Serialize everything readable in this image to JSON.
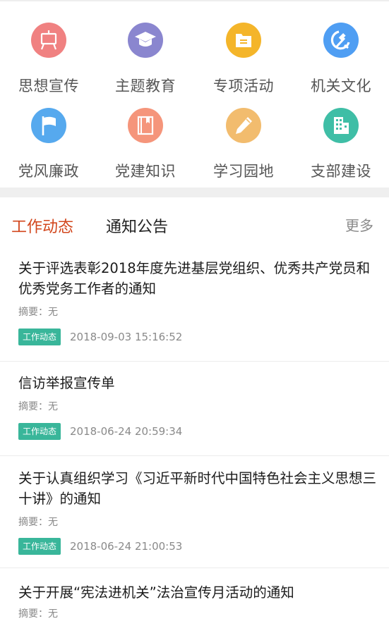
{
  "menu": [
    {
      "label": "思想宣传",
      "icon": "blackboard-icon",
      "color": "#f08181"
    },
    {
      "label": "主题教育",
      "icon": "graduation-cap-icon",
      "color": "#8a86cf"
    },
    {
      "label": "专项活动",
      "icon": "folder-icon",
      "color": "#f4b52a"
    },
    {
      "label": "机关文化",
      "icon": "hammer-sickle-icon",
      "color": "#4f9ef3"
    },
    {
      "label": "党风廉政",
      "icon": "flag-icon",
      "color": "#56a9ee"
    },
    {
      "label": "党建知识",
      "icon": "book-icon",
      "color": "#f5957b"
    },
    {
      "label": "学习园地",
      "icon": "pencil-icon",
      "color": "#f2bc6e"
    },
    {
      "label": "支部建设",
      "icon": "building-icon",
      "color": "#3fbea6"
    }
  ],
  "tabs": {
    "active": "工作动态",
    "other": "通知公告",
    "more": "更多"
  },
  "accent_color": "#d2461c",
  "badge_color": "#39b69a",
  "news": [
    {
      "title": "关于评选表彰2018年度先进基层党组织、优秀共产党员和优秀党务工作者的通知",
      "summary": "摘要：无",
      "tag": "工作动态",
      "time": "2018-09-03 15:16:52"
    },
    {
      "title": "信访举报宣传单",
      "summary": "摘要：无",
      "tag": "工作动态",
      "time": "2018-06-24 20:59:34"
    },
    {
      "title": "关于认真组织学习《习近平新时代中国特色社会主义思想三十讲》的通知",
      "summary": "摘要：无",
      "tag": "工作动态",
      "time": "2018-06-24 21:00:53"
    },
    {
      "title": "关于开展“宪法进机关”法治宣传月活动的通知",
      "summary": "摘要：无"
    }
  ]
}
